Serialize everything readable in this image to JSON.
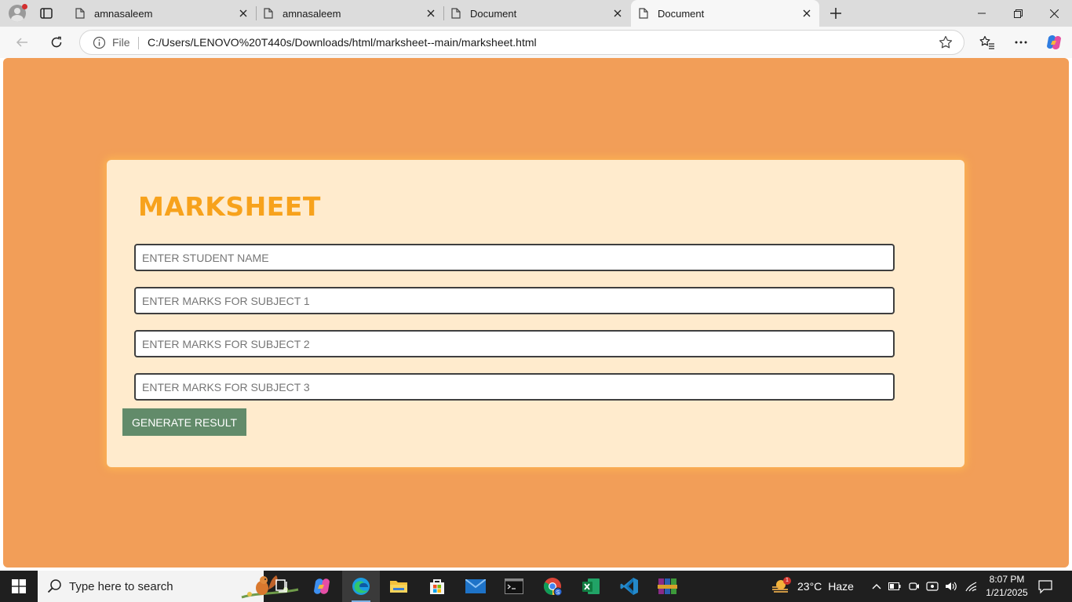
{
  "browser": {
    "tabs": [
      {
        "title": "amnasaleem",
        "active": false
      },
      {
        "title": "amnasaleem",
        "active": false
      },
      {
        "title": "Document",
        "active": false
      },
      {
        "title": "Document",
        "active": true
      }
    ],
    "address": {
      "scheme_label": "File",
      "url": "C:/Users/LENOVO%20T440s/Downloads/html/marksheet--main/marksheet.html"
    }
  },
  "page": {
    "title": "MARKSHEET",
    "fields": [
      {
        "placeholder": "ENTER STUDENT NAME"
      },
      {
        "placeholder": "ENTER MARKS FOR SUBJECT 1"
      },
      {
        "placeholder": "ENTER MARKS FOR SUBJECT 2"
      },
      {
        "placeholder": "ENTER MARKS FOR SUBJECT 3"
      }
    ],
    "button_label": "GENERATE RESULT",
    "colors": {
      "background": "#f29e58",
      "card": "#ffebcd",
      "title": "#f7a21c",
      "button": "#628b6a"
    }
  },
  "taskbar": {
    "search_placeholder": "Type here to search",
    "apps": [
      "task-view",
      "copilot",
      "edge",
      "file-explorer",
      "microsoft-store",
      "mail",
      "terminal",
      "chrome",
      "excel",
      "vs-code",
      "winrar"
    ],
    "weather": {
      "temp": "23°C",
      "condition": "Haze",
      "badge": "1"
    },
    "clock": {
      "time": "8:07 PM",
      "date": "1/21/2025"
    }
  }
}
